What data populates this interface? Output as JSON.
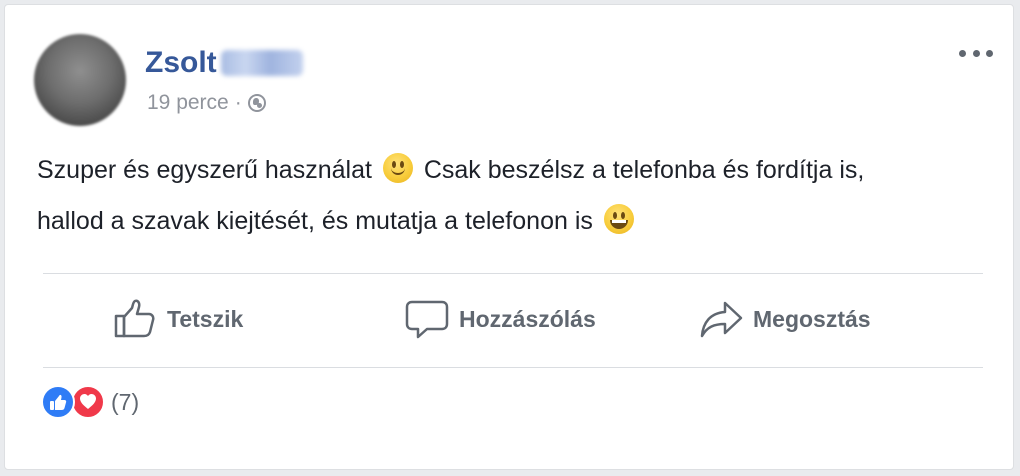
{
  "post": {
    "author": "Zsolt",
    "timestamp": "19 perce",
    "separator": "·",
    "privacy_icon": "globe-icon",
    "text_line_1_a": "Szuper és egyszerű használat",
    "text_line_1_b": "Csak beszélsz a telefonba és fordítja is,",
    "text_line_2": "hallod a szavak kiejtését, és mutatja a telefonon is",
    "emoji_1": "slightly-smiling-face",
    "emoji_2": "grinning-face"
  },
  "actions": {
    "like_label": "Tetszik",
    "comment_label": "Hozzászólás",
    "share_label": "Megosztás"
  },
  "reactions": {
    "count": "(7)",
    "types": [
      "like",
      "love"
    ]
  },
  "colors": {
    "author": "#365899",
    "meta": "#90949c",
    "action": "#606770",
    "like": "#2f7cf6",
    "love": "#f0394a"
  }
}
